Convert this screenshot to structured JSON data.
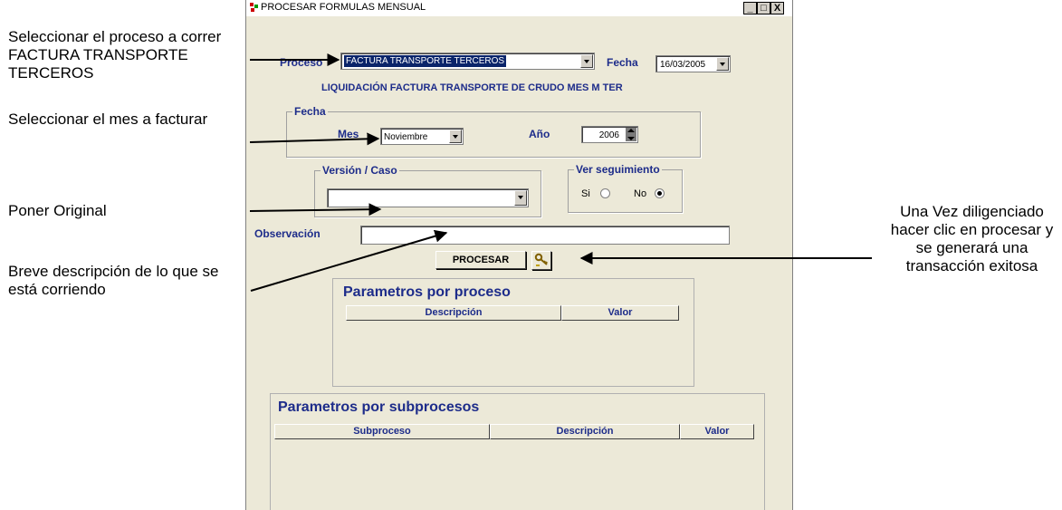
{
  "annotations": {
    "proceso": "Seleccionar el proceso a correr FACTURA TRANSPORTE TERCEROS",
    "mes": "Seleccionar el mes a facturar",
    "original": "Poner Original",
    "descripcion": "Breve descripción de lo que se está corriendo",
    "procesar": "Una Vez diligenciado hacer clic en procesar y se generará una transacción exitosa"
  },
  "window": {
    "title": "PROCESAR FORMULAS MENSUAL",
    "minimize": "_",
    "maximize": "□",
    "close": "X"
  },
  "form": {
    "proceso_label": "Proceso",
    "proceso_value": "FACTURA TRANSPORTE TERCEROS",
    "fecha_label": "Fecha",
    "fecha_value": "16/03/2005",
    "liquidacion_text": "LIQUIDACIÓN FACTURA TRANSPORTE DE CRUDO MES M TER",
    "fecha_group_label": "Fecha",
    "mes_label": "Mes",
    "mes_value": "Noviembre",
    "anio_label": "Año",
    "anio_value": "2006",
    "version_label": "Versión / Caso",
    "version_value": "",
    "seguimiento_label": "Ver seguimiento",
    "si_label": "Si",
    "no_label": "No",
    "seguimiento_selected": "No",
    "observacion_label": "Observación",
    "observacion_value": "",
    "procesar_label": "PROCESAR"
  },
  "parametros_proceso": {
    "title": "Parametros por proceso",
    "columns": [
      "Descripción",
      "Valor"
    ]
  },
  "parametros_subprocesos": {
    "title": "Parametros por subprocesos",
    "columns": [
      "Subproceso",
      "Descripción",
      "Valor"
    ]
  },
  "colors": {
    "label_blue": "#1d2c8a",
    "window_bg": "#ece9d8",
    "selection": "#0a246a"
  }
}
